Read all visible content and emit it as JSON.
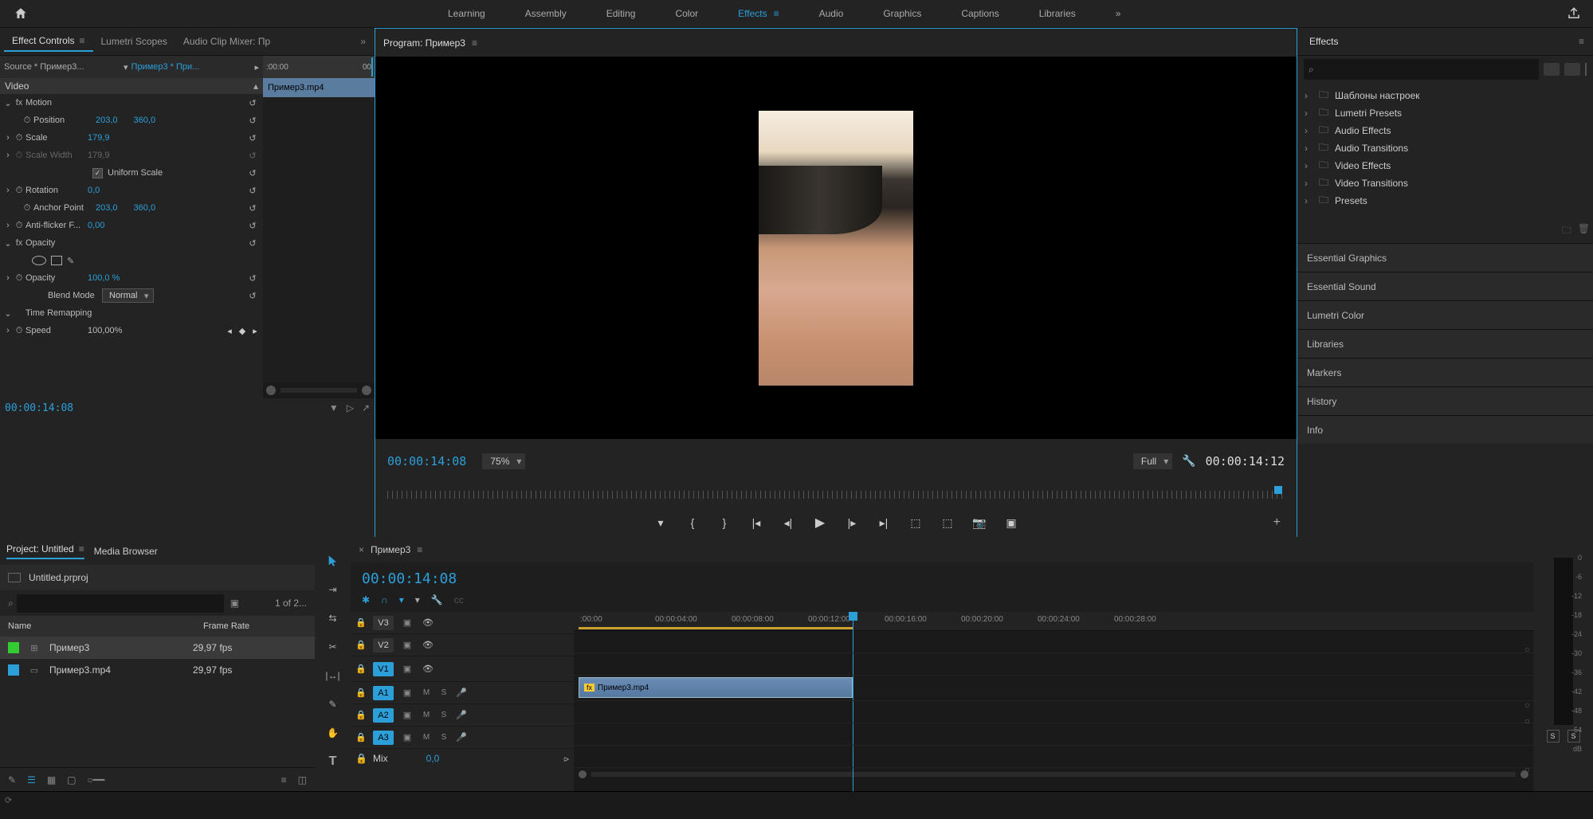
{
  "topbar": {
    "workspaces": [
      "Learning",
      "Assembly",
      "Editing",
      "Color",
      "Effects",
      "Audio",
      "Graphics",
      "Captions",
      "Libraries"
    ],
    "active": "Effects"
  },
  "panel_tabs_left": {
    "t1": "Effect Controls",
    "t2": "Lumetri Scopes",
    "t3": "Audio Clip Mixer: Пр"
  },
  "source": {
    "left": "Source * Пример3...",
    "right": "Пример3 * При...",
    "tc0": ":00:00",
    "tc1": "00",
    "clip": "Пример3.mp4"
  },
  "effcon": {
    "video": "Video",
    "motion": "Motion",
    "position": "Position",
    "pos_x": "203,0",
    "pos_y": "360,0",
    "scale": "Scale",
    "scale_v": "179,9",
    "scalew": "Scale Width",
    "scalew_v": "179,9",
    "uniform": "Uniform Scale",
    "rotation": "Rotation",
    "rot_v": "0,0",
    "anchor": "Anchor Point",
    "anc_x": "203,0",
    "anc_y": "360,0",
    "anti": "Anti-flicker F...",
    "anti_v": "0,00",
    "opacity": "Opacity",
    "opac_lbl": "Opacity",
    "opac_v": "100,0 %",
    "blend": "Blend Mode",
    "blend_v": "Normal",
    "time": "Time Remapping",
    "speed": "Speed",
    "speed_v": "100,00%"
  },
  "foot_tc": "00:00:14:08",
  "program": {
    "title": "Program: Пример3",
    "tc": "00:00:14:08",
    "zoom": "75%",
    "full": "Full",
    "dur": "00:00:14:12"
  },
  "effects_panel": {
    "title": "Effects",
    "items": [
      "Шаблоны настроек",
      "Lumetri Presets",
      "Audio Effects",
      "Audio Transitions",
      "Video Effects",
      "Video Transitions",
      "Presets"
    ]
  },
  "side_panels": [
    "Essential Graphics",
    "Essential Sound",
    "Lumetri Color",
    "Libraries",
    "Markers",
    "History",
    "Info"
  ],
  "project": {
    "tab1": "Project: Untitled",
    "tab2": "Media Browser",
    "file": "Untitled.prproj",
    "count": "1 of 2...",
    "col_name": "Name",
    "col_fr": "Frame Rate",
    "row1": {
      "name": "Пример3",
      "fr": "29,97 fps"
    },
    "row2": {
      "name": "Пример3.mp4",
      "fr": "29,97 fps"
    }
  },
  "timeline": {
    "seq": "Пример3",
    "tc": "00:00:14:08",
    "ruler": [
      ":00:00",
      "00:00:04:00",
      "00:00:08:00",
      "00:00:12:00",
      "00:00:16:00",
      "00:00:20:00",
      "00:00:24:00",
      "00:00:28:00"
    ],
    "v3": "V3",
    "v2": "V2",
    "v1": "V1",
    "a1": "A1",
    "a2": "A2",
    "a3": "A3",
    "mix": "Mix",
    "mixv": "0,0",
    "clip": "Пример3.mp4",
    "fx": "fx"
  },
  "meters": {
    "labels": [
      "0",
      "-6",
      "-12",
      "-18",
      "-24",
      "-30",
      "-36",
      "-42",
      "-48",
      "-54",
      "dB"
    ],
    "s": "S"
  }
}
